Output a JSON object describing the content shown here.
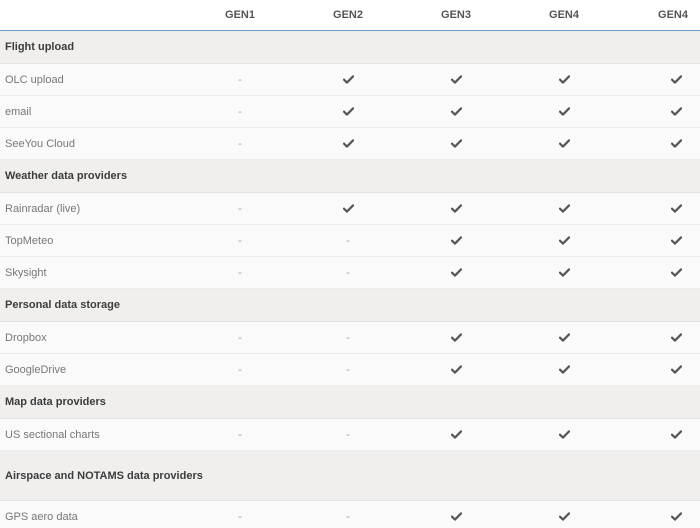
{
  "header": {
    "columns": [
      "",
      "GEN1",
      "GEN2",
      "GEN3",
      "GEN4",
      "GEN4"
    ]
  },
  "sections": [
    {
      "title": "Flight upload",
      "rows": [
        {
          "label": "OLC upload",
          "values": [
            "-",
            "check",
            "check",
            "check",
            "check"
          ]
        },
        {
          "label": "email",
          "values": [
            "-",
            "check",
            "check",
            "check",
            "check"
          ]
        },
        {
          "label": "SeeYou Cloud",
          "values": [
            "-",
            "check",
            "check",
            "check",
            "check"
          ]
        }
      ]
    },
    {
      "title": "Weather data providers",
      "rows": [
        {
          "label": "Rainradar (live)",
          "values": [
            "-",
            "check",
            "check",
            "check",
            "check"
          ]
        },
        {
          "label": "TopMeteo",
          "values": [
            "-",
            "-",
            "check",
            "check",
            "check"
          ]
        },
        {
          "label": "Skysight",
          "values": [
            "-",
            "-",
            "check",
            "check",
            "check"
          ]
        }
      ]
    },
    {
      "title": "Personal data storage",
      "rows": [
        {
          "label": "Dropbox",
          "values": [
            "-",
            "-",
            "check",
            "check",
            "check"
          ]
        },
        {
          "label": "GoogleDrive",
          "values": [
            "-",
            "-",
            "check",
            "check",
            "check"
          ]
        }
      ]
    },
    {
      "title": "Map data providers",
      "rows": [
        {
          "label": "US sectional charts",
          "values": [
            "-",
            "-",
            "check",
            "check",
            "check"
          ]
        }
      ]
    },
    {
      "title": "Airspace and NOTAMS data providers",
      "rows": [
        {
          "label": "GPS aero data",
          "values": [
            "-",
            "-",
            "check",
            "check",
            "check"
          ]
        }
      ]
    }
  ],
  "icons": {
    "check": "check-icon"
  },
  "colors": {
    "header_rule": "#6b9bc8",
    "check": "#555555",
    "section_bg": "#f0efee"
  }
}
